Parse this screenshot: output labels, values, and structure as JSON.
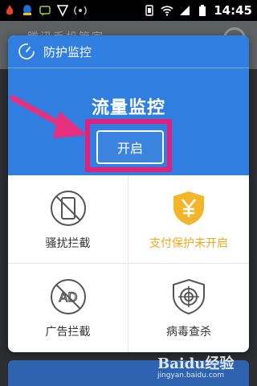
{
  "status_bar": {
    "time": "14:45"
  },
  "background_app": {
    "title": "腾讯手机管家"
  },
  "dialog": {
    "header_title": "防护监控",
    "main_title": "流量监控",
    "open_button": "开启",
    "features": [
      {
        "label": "骚扰拦截",
        "icon": "phone-blocked-icon",
        "status": "normal"
      },
      {
        "label": "支付保护未开启",
        "icon": "yen-shield-icon",
        "status": "warning"
      },
      {
        "label": "广告拦截",
        "icon": "ad-blocked-icon",
        "status": "normal"
      },
      {
        "label": "病毒查杀",
        "icon": "crosshair-shield-icon",
        "status": "normal"
      }
    ]
  },
  "watermark": {
    "logo": "Baidu经验",
    "url": "jingyan.baidu.com"
  },
  "colors": {
    "dialog_blue": "#2f7ee0",
    "highlight": "#e0207a",
    "warning": "#f0a81e"
  }
}
